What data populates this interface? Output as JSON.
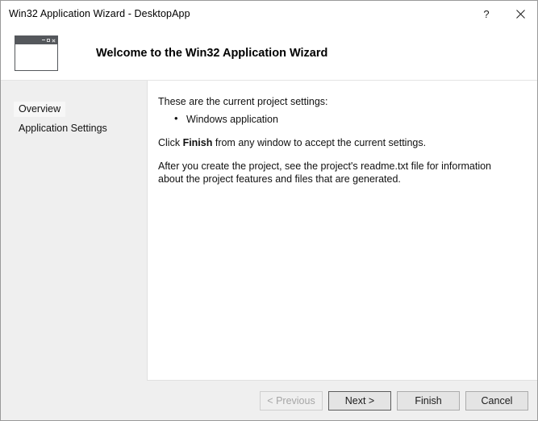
{
  "window": {
    "title": "Win32 Application Wizard - DesktopApp",
    "caption_buttons": [
      {
        "name": "help",
        "glyph": "?"
      },
      {
        "name": "close",
        "glyph": "✕"
      }
    ]
  },
  "header": {
    "icon_name": "window-app-icon",
    "title": "Welcome to the Win32 Application Wizard"
  },
  "sidebar": {
    "items": [
      {
        "label": "Overview",
        "selected": true
      },
      {
        "label": "Application Settings",
        "selected": false
      }
    ]
  },
  "content": {
    "intro": "These are the current project settings:",
    "settings": [
      "Windows application"
    ],
    "finish_line": {
      "prefix": "Click ",
      "bold": "Finish",
      "suffix": " from any window to accept the current settings."
    },
    "readme_note": "After you create the project, see the project's readme.txt file for information about the project features and files that are generated."
  },
  "footer": {
    "buttons": [
      {
        "label": "< Previous",
        "state": "disabled"
      },
      {
        "label": "Next >",
        "state": "default"
      },
      {
        "label": "Finish",
        "state": "normal"
      },
      {
        "label": "Cancel",
        "state": "normal"
      }
    ]
  },
  "colors": {
    "window_border": "#9a9a9a",
    "sidebar_bg": "#efefef",
    "content_bg": "#ffffff",
    "icon_titlebar": "#55585c",
    "button_bg": "#e4e4e4",
    "button_border": "#acacac",
    "disabled_text": "#a6a6a6"
  }
}
